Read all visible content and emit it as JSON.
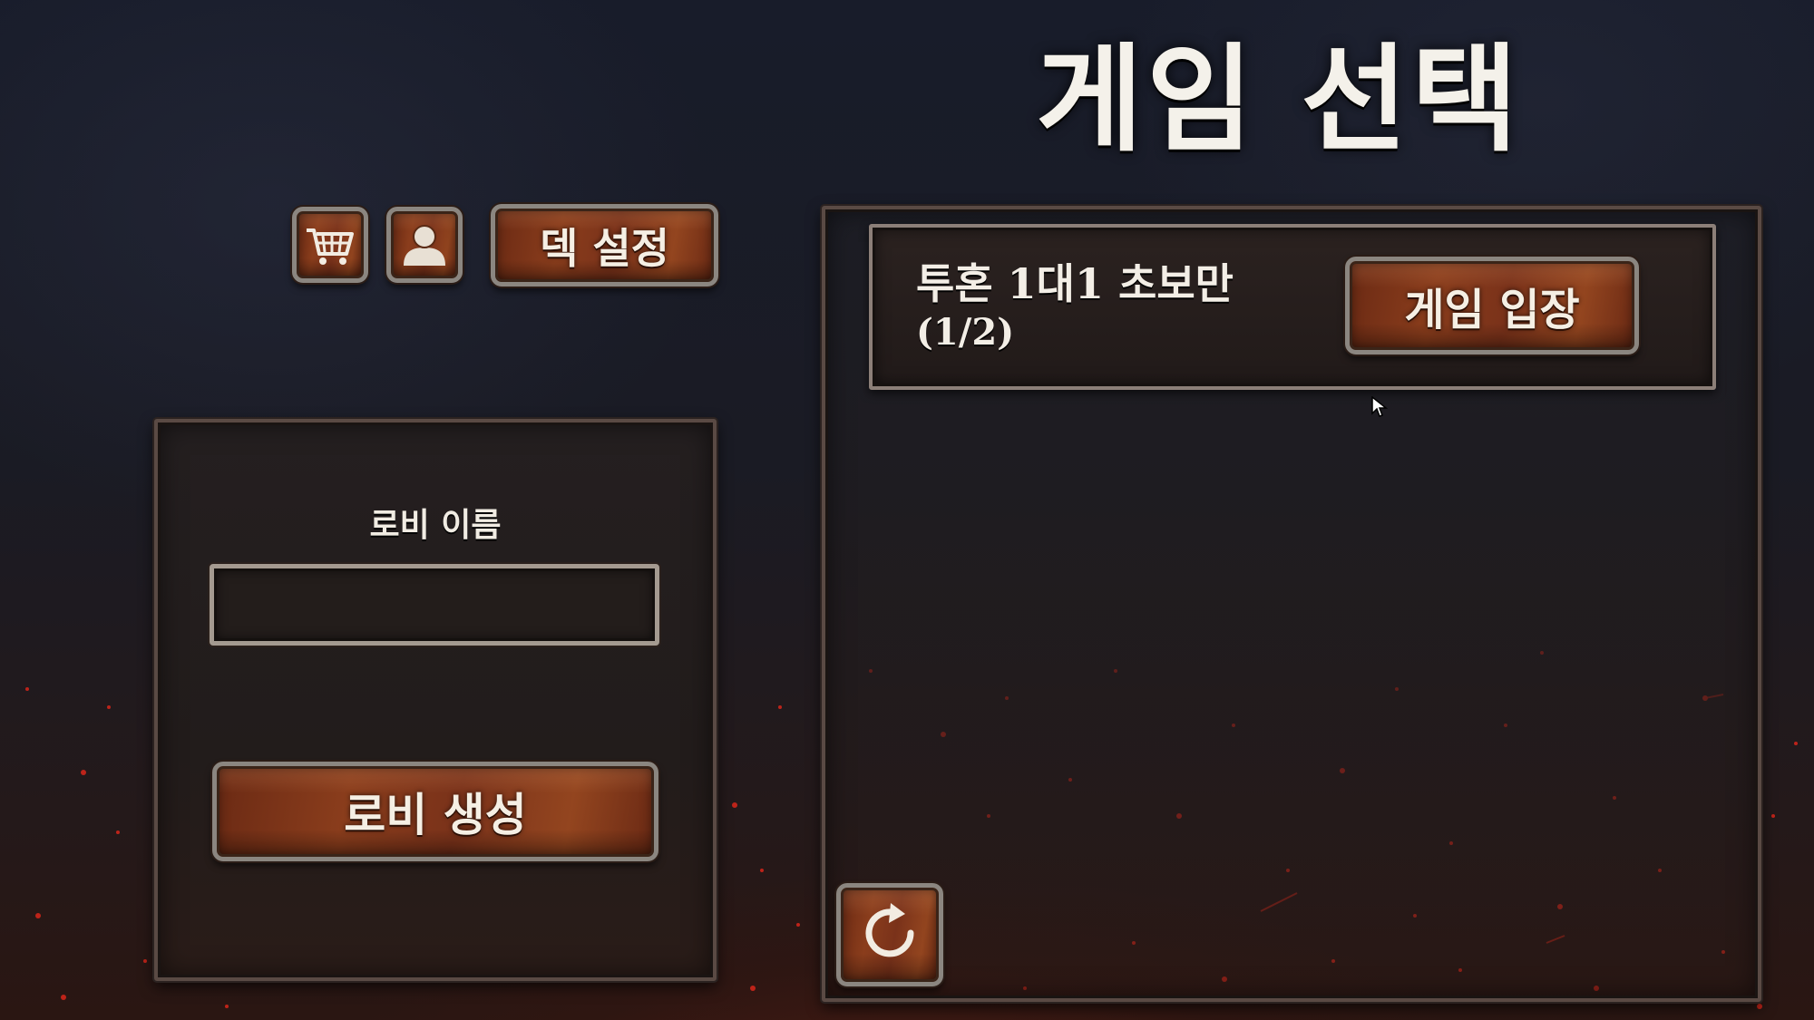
{
  "screen": {
    "title": "게임 선택"
  },
  "toolbar": {
    "shop_icon": "shopping-cart-icon",
    "profile_icon": "user-silhouette-icon",
    "deck_button_label": "덱 설정"
  },
  "create_lobby": {
    "name_label": "로비 이름",
    "name_value": "",
    "name_placeholder": "",
    "create_button_label": "로비 생성"
  },
  "games": [
    {
      "name": "투혼 1대1 초보만",
      "players": "(1/2)",
      "join_button_label": "게임 입장"
    }
  ],
  "refresh": {
    "icon": "refresh-icon"
  },
  "colors": {
    "button_wood": "#8a3d1c",
    "button_frame": "#8b8680",
    "panel_bg": "#231d1b",
    "text": "#f4f1ea",
    "ember": "#d8261a"
  }
}
